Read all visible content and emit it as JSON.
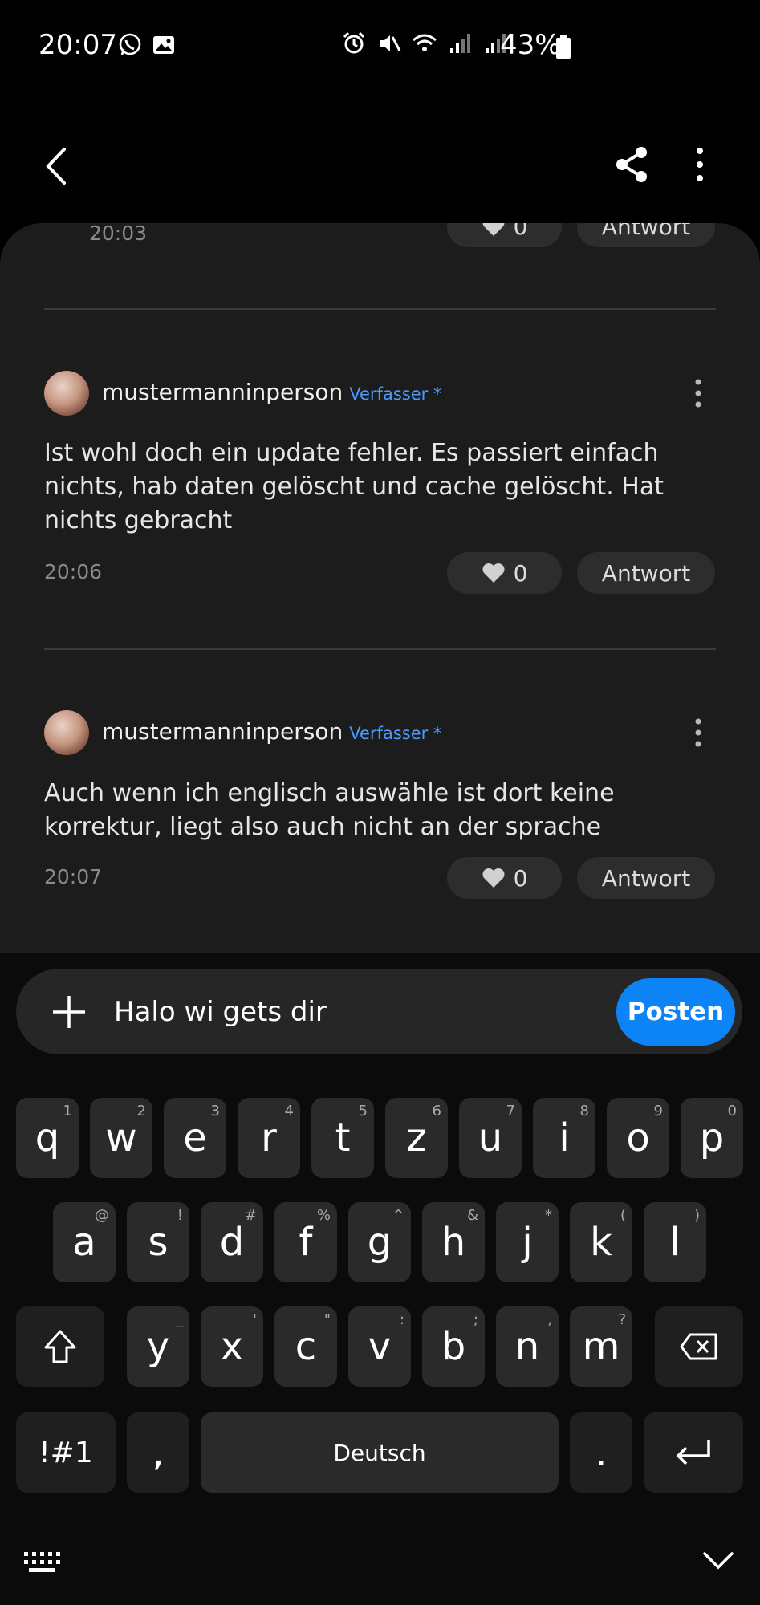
{
  "status_bar": {
    "time": "20:07",
    "battery": "43%"
  },
  "comments_top": {
    "time": "20:03",
    "likes": "0",
    "reply_label": "Antwort"
  },
  "comments": [
    {
      "author": "mustermanninperson",
      "badge": "Verfasser *",
      "text": "Ist wohl doch ein update fehler. Es passiert einfach nichts, hab daten gelöscht und cache gelöscht. Hat nichts gebracht",
      "time": "20:06",
      "likes": "0",
      "reply_label": "Antwort"
    },
    {
      "author": "mustermanninperson",
      "badge": "Verfasser *",
      "text": "Auch wenn ich englisch auswähle ist dort keine korrektur, liegt also auch nicht an der sprache",
      "time": "20:07",
      "likes": "0",
      "reply_label": "Antwort"
    }
  ],
  "compose": {
    "value": "Halo wi gets dir",
    "post_label": "Posten"
  },
  "keyboard": {
    "row1": [
      {
        "k": "q",
        "h": "1"
      },
      {
        "k": "w",
        "h": "2"
      },
      {
        "k": "e",
        "h": "3"
      },
      {
        "k": "r",
        "h": "4"
      },
      {
        "k": "t",
        "h": "5"
      },
      {
        "k": "z",
        "h": "6"
      },
      {
        "k": "u",
        "h": "7"
      },
      {
        "k": "i",
        "h": "8"
      },
      {
        "k": "o",
        "h": "9"
      },
      {
        "k": "p",
        "h": "0"
      }
    ],
    "row2": [
      {
        "k": "a",
        "h": "@"
      },
      {
        "k": "s",
        "h": "!"
      },
      {
        "k": "d",
        "h": "#"
      },
      {
        "k": "f",
        "h": "%"
      },
      {
        "k": "g",
        "h": "^"
      },
      {
        "k": "h",
        "h": "&"
      },
      {
        "k": "j",
        "h": "*"
      },
      {
        "k": "k",
        "h": "("
      },
      {
        "k": "l",
        "h": ")"
      }
    ],
    "row3": [
      {
        "k": "y",
        "h": "_"
      },
      {
        "k": "x",
        "h": "'"
      },
      {
        "k": "c",
        "h": "\""
      },
      {
        "k": "v",
        "h": ":"
      },
      {
        "k": "b",
        "h": ";"
      },
      {
        "k": "n",
        "h": ","
      },
      {
        "k": "m",
        "h": "?"
      }
    ],
    "symbols_label": "!#1",
    "comma": ",",
    "space_label": "Deutsch",
    "period": "."
  },
  "colors": {
    "accent": "#0d84f5",
    "badge": "#4a9bff",
    "sheet": "#1c1c1c"
  }
}
